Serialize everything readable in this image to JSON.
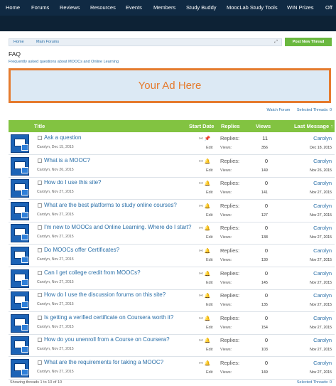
{
  "nav": [
    "Home",
    "Forums",
    "Reviews",
    "Resources",
    "Events",
    "Members",
    "Study Buddy",
    "MoocLab Study Tools",
    "WIN Prizes",
    "Off"
  ],
  "breadcrumb": {
    "home": "Home",
    "forums": "Main Forums"
  },
  "post_new_thread": "Post New Thread",
  "forum": {
    "title": "FAQ",
    "description": "Frequently asked questions about MOOCs and Online Learning"
  },
  "ad_text": "Your Ad Here",
  "watch_forum": "Watch Forum",
  "selected_threads": "Selected Threads: 0",
  "columns": {
    "title": "Title",
    "start_date": "Start Date",
    "replies": "Replies",
    "views": "Views",
    "last_message": "Last Message ↑"
  },
  "labels": {
    "replies": "Replies:",
    "views": "Views:",
    "edit": "Edit"
  },
  "threads": [
    {
      "title": "Ask a question",
      "meta": "Carolyn, Dec 15, 2015",
      "replies": "11",
      "views": "356",
      "last_user": "Carolyn",
      "last_date": "Dec 18, 2015",
      "sticky": true
    },
    {
      "title": "What is a MOOC?",
      "meta": "Carolyn, Nov 26, 2015",
      "replies": "0",
      "views": "149",
      "last_user": "Carolyn",
      "last_date": "Nov 26, 2015"
    },
    {
      "title": "How do I use this site?",
      "meta": "Carolyn, Nov 27, 2015",
      "replies": "0",
      "views": "141",
      "last_user": "Carolyn",
      "last_date": "Nov 27, 2015"
    },
    {
      "title": "What are the best platforms to study online courses?",
      "meta": "Carolyn, Nov 27, 2015",
      "replies": "0",
      "views": "127",
      "last_user": "Carolyn",
      "last_date": "Nov 27, 2015"
    },
    {
      "title": "I'm new to MOOCs and Online Learning. Where do I start?",
      "meta": "Carolyn, Nov 27, 2015",
      "replies": "0",
      "views": "138",
      "last_user": "Carolyn",
      "last_date": "Nov 27, 2015"
    },
    {
      "title": "Do MOOCs offer Certificates?",
      "meta": "Carolyn, Nov 27, 2015",
      "replies": "0",
      "views": "130",
      "last_user": "Carolyn",
      "last_date": "Nov 27, 2015"
    },
    {
      "title": "Can I get college credit from MOOCs?",
      "meta": "Carolyn, Nov 27, 2015",
      "replies": "0",
      "views": "145",
      "last_user": "Carolyn",
      "last_date": "Nov 27, 2015"
    },
    {
      "title": "How do I use the discussion forums on this site?",
      "meta": "Carolyn, Nov 27, 2015",
      "replies": "0",
      "views": "135",
      "last_user": "Carolyn",
      "last_date": "Nov 27, 2015"
    },
    {
      "title": "Is getting a verified certificate on Coursera worth it?",
      "meta": "Carolyn, Nov 27, 2015",
      "replies": "0",
      "views": "154",
      "last_user": "Carolyn",
      "last_date": "Nov 27, 2015"
    },
    {
      "title": "How do you unenroll from a Course on Coursera?",
      "meta": "Carolyn, Nov 27, 2015",
      "replies": "0",
      "views": "103",
      "last_user": "Carolyn",
      "last_date": "Nov 27, 2015"
    },
    {
      "title": "What are the requirements for taking a MOOC?",
      "meta": "Carolyn, Nov 27, 2015",
      "replies": "0",
      "views": "149",
      "last_user": "Carolyn",
      "last_date": "Nov 27, 2015"
    }
  ],
  "footer": {
    "showing": "Showing threads 1 to 10 of 10",
    "selected": "Selected Threads: 0"
  },
  "colors": {
    "nav_bg": "#102a43",
    "header_green": "#82c341",
    "button_green": "#6ab83f",
    "ad_border": "#e57b2e",
    "link": "#2a6fa8"
  }
}
